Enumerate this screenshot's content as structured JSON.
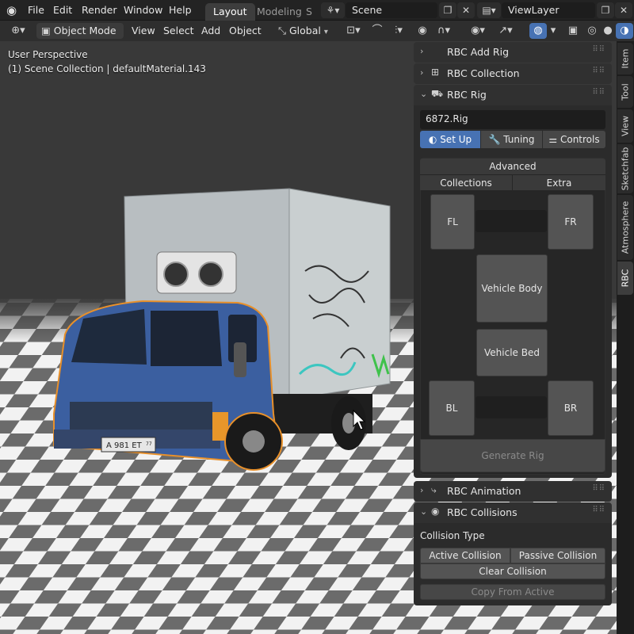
{
  "topbar": {
    "menus": [
      "File",
      "Edit",
      "Render",
      "Window",
      "Help"
    ],
    "workspace_tabs": [
      "Layout",
      "Modeling",
      "S"
    ],
    "active_workspace": "Layout",
    "scene": "Scene",
    "view_layer": "ViewLayer"
  },
  "header": {
    "mode": "Object Mode",
    "menus": [
      "View",
      "Select",
      "Add",
      "Object"
    ],
    "transform_orientation": "Global"
  },
  "viewport": {
    "perspective_label": "User Perspective",
    "context_label": "(1) Scene Collection | defaultMaterial.143",
    "license_plate": "А 981 ЕТ",
    "plate_region": "77"
  },
  "npanel": {
    "panels": [
      {
        "title": "RBC Add Rig",
        "expanded": false
      },
      {
        "title": "RBC Collection",
        "expanded": false
      },
      {
        "title": "RBC Rig",
        "expanded": true
      },
      {
        "title": "RBC Animation",
        "expanded": false
      },
      {
        "title": "RBC Collisions",
        "expanded": true
      }
    ],
    "rig": {
      "name": "6872.Rig",
      "tabs": [
        "Set Up",
        "Tuning",
        "Controls"
      ],
      "active_tab": "Set Up",
      "advanced_label": "Advanced",
      "subtabs": [
        "Collections",
        "Extra"
      ],
      "wheels": {
        "fl": "FL",
        "fr": "FR",
        "bl": "BL",
        "br": "BR"
      },
      "vehicle_body": "Vehicle Body",
      "vehicle_bed": "Vehicle Bed",
      "generate": "Generate Rig"
    },
    "collisions": {
      "type_label": "Collision Type",
      "active": "Active Collision",
      "passive": "Passive Collision",
      "clear": "Clear Collision",
      "copy": "Copy From Active"
    }
  },
  "sidetabs": [
    "Item",
    "Tool",
    "View",
    "Sketchfab",
    "Atmosphere",
    "RBC"
  ],
  "colors": {
    "accent": "#4772b3",
    "panel": "#2b2b2b",
    "button": "#545454",
    "truck_cab": "#3b5fa0",
    "selection_outline": "#e8902a"
  }
}
